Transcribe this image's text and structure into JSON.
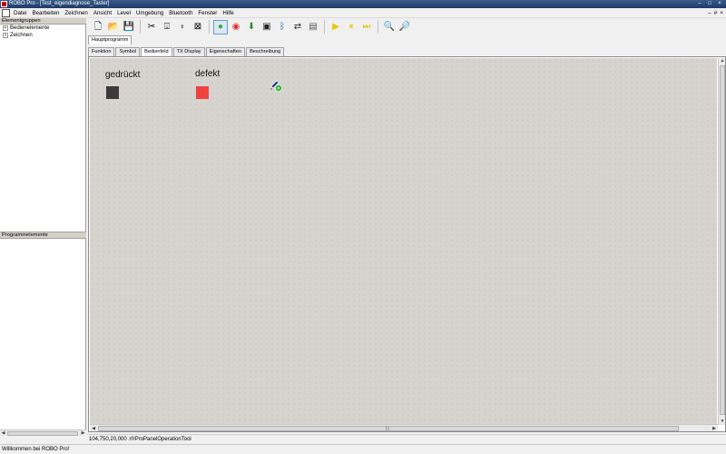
{
  "window": {
    "title": "ROBO Pro - [Test_eigendiagnose_Taster]",
    "controls": [
      "–",
      "□",
      "×"
    ]
  },
  "menubar": {
    "items": [
      "Datei",
      "Bearbeiten",
      "Zeichnen",
      "Ansicht",
      "Level",
      "Umgebung",
      "Bluetooth",
      "Fenster",
      "Hilfe"
    ],
    "mdi_controls": [
      "–",
      "#",
      "×"
    ]
  },
  "left_panel": {
    "groups_header": "Elementgruppen",
    "groups": [
      {
        "label": "Bedienelemente",
        "expander": "+"
      },
      {
        "label": "Zeichnen",
        "expander": "+"
      }
    ],
    "program_header": "Programmelemente"
  },
  "toolbar": {
    "buttons": [
      {
        "name": "new-file-icon",
        "glyph": "🗋"
      },
      {
        "name": "open-folder-icon",
        "glyph": "📂"
      },
      {
        "name": "save-icon",
        "glyph": "💾"
      },
      {
        "name": "cut-icon",
        "glyph": "✂"
      },
      {
        "name": "new-subprogram-icon",
        "glyph": "⍗"
      },
      {
        "name": "copy-subprogram-icon",
        "glyph": "⍖"
      },
      {
        "name": "delete-subprogram-icon",
        "glyph": "⊠"
      },
      {
        "name": "start-icon",
        "glyph": "●",
        "color": "#2bb52b",
        "active": true
      },
      {
        "name": "stop-icon",
        "glyph": "◉",
        "color": "#e03030"
      },
      {
        "name": "download-icon",
        "glyph": "⬇",
        "color": "#2a8a2a"
      },
      {
        "name": "robotx-icon",
        "glyph": "▣",
        "color": "#222"
      },
      {
        "name": "bluetooth-icon",
        "glyph": "ᛒ",
        "color": "#1565c0"
      },
      {
        "name": "com-usb-icon",
        "glyph": "⇄",
        "color": "#333"
      },
      {
        "name": "window-icon",
        "glyph": "▤",
        "color": "#555"
      },
      {
        "name": "play-icon",
        "glyph": "▶",
        "color": "#e6c800"
      },
      {
        "name": "pause-icon",
        "glyph": "⏸",
        "color": "#e6c800"
      },
      {
        "name": "step-icon",
        "glyph": "⏭",
        "color": "#e6c800"
      },
      {
        "name": "zoom-out-icon",
        "glyph": "🔍",
        "color": "#333"
      },
      {
        "name": "zoom-in-icon",
        "glyph": "🔎",
        "color": "#333"
      }
    ]
  },
  "program_tabs": [
    "Hauptprogramm"
  ],
  "view_tabs": {
    "items": [
      "Funktion",
      "Symbol",
      "Bedienfeld",
      "TX Display",
      "Eigenschaften",
      "Beschreibung"
    ],
    "selected": "Bedienfeld"
  },
  "canvas": {
    "background": "#d7d3ce",
    "indicators": [
      {
        "label": "gedrückt",
        "color": "#3a3a3a"
      },
      {
        "label": "defekt",
        "color": "#f04040"
      }
    ]
  },
  "statusbar": {
    "text": "104,750,20,000 :rfrProPanelOperationTool"
  },
  "bottom_status": {
    "text": "Willkommen bei ROBO Pro!"
  }
}
